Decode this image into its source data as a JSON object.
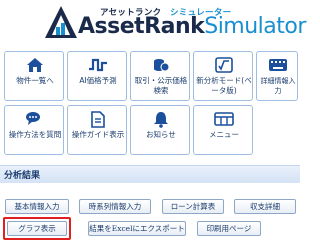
{
  "logo": {
    "ruby_kana": "アセットランク",
    "ruby_sim": "シミュレーター",
    "name_part1": "AssetRank",
    "name_part2": "Simulator"
  },
  "menu": {
    "items": [
      {
        "label": "物件一覧へ",
        "icon": "home-icon"
      },
      {
        "label": "AI価格予測",
        "icon": "waveform-icon"
      },
      {
        "label": "取引・公示価格検索",
        "icon": "coins-icon"
      },
      {
        "label": "新分析モード(ベータ版)",
        "icon": "sqrt-formula-icon"
      },
      {
        "label": "詳細情報入力",
        "icon": "keyboard-icon"
      },
      {
        "label": "操作方法を質問",
        "icon": "chat-bubbles-icon"
      },
      {
        "label": "操作ガイド表示",
        "icon": "document-icon"
      },
      {
        "label": "お知らせ",
        "icon": "bell-icon"
      },
      {
        "label": "メニュー",
        "icon": "grid-menu-icon"
      }
    ]
  },
  "analysis": {
    "title": "分析結果",
    "buttons": [
      "基本情報入力",
      "時系列情報入力",
      "ローン計算表",
      "収支詳細",
      "グラフ表示",
      "結果をExcelにエクスポート",
      "印刷用ページ"
    ]
  },
  "colors": {
    "accent": "#1a8fd0",
    "navy": "#1c3d6e",
    "highlight": "#e02020"
  }
}
